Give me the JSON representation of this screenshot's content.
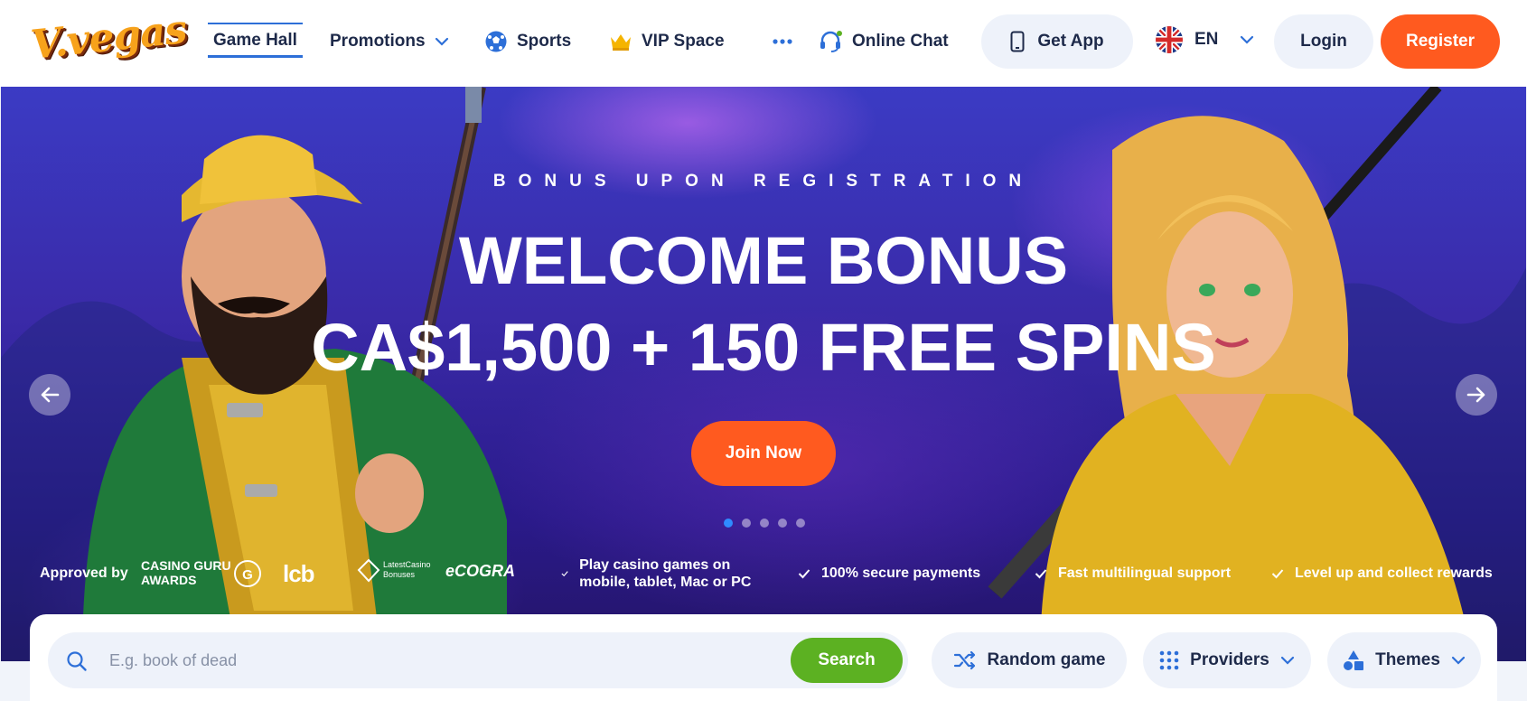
{
  "header": {
    "logo_text": "V.vegas",
    "nav": [
      {
        "label": "Game Hall",
        "icon": "none"
      },
      {
        "label": "Promotions",
        "icon": "chevron-down-icon"
      },
      {
        "label": "Sports",
        "icon": "soccer-ball-icon"
      },
      {
        "label": "VIP Space",
        "icon": "crown-icon"
      },
      {
        "label": "",
        "icon": "more-dots-icon"
      },
      {
        "label": "Online Chat",
        "icon": "headset-icon"
      }
    ],
    "get_app_label": "Get App",
    "language_label": "EN",
    "login_label": "Login",
    "register_label": "Register"
  },
  "hero": {
    "eyebrow": "BONUS UPON REGISTRATION",
    "headline_1": "WELCOME BONUS",
    "headline_2": "CA$1,500 + 150 FREE SPINS",
    "cta_label": "Join Now",
    "slides_count": 5,
    "active_slide": 1,
    "approved_by_label": "Approved by",
    "badges": {
      "casino_guru": "CASINO GURU AWARDS",
      "lcb": "lcb",
      "latest_casino": "LatestCasino Bonuses",
      "ecogra": "eCOGRA"
    },
    "features": [
      "Play casino games on mobile, tablet, Mac or PC",
      "100% secure payments",
      "Fast multilingual support",
      "Level up and collect rewards"
    ]
  },
  "search": {
    "placeholder": "E.g. book of dead",
    "button_label": "Search",
    "random_label": "Random game",
    "providers_label": "Providers",
    "themes_label": "Themes"
  },
  "colors": {
    "accent_orange": "#ff5a1f",
    "accent_green": "#5cb122",
    "nav_active_blue": "#2d6fd8",
    "text_dark": "#1e2a4a"
  }
}
